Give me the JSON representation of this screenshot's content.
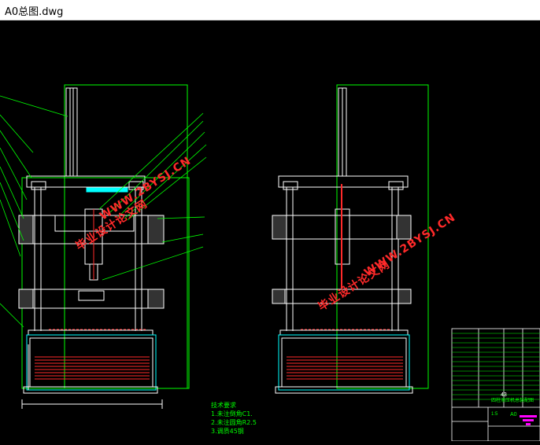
{
  "window": {
    "title": "A0总图.dwg"
  },
  "watermarks": [
    {
      "text": "毕业设计论文网"
    },
    {
      "text": "WWW.2BYSJ.CN"
    },
    {
      "text": "毕业设计论文网"
    },
    {
      "text": "WWW.2BYSJ.CN"
    }
  ],
  "technical_notes": {
    "heading": "技术要求",
    "items": [
      "1.未注倒角C1.",
      "2.未注圆角R2.5",
      "3.调质45钢"
    ]
  },
  "title_block": {
    "drawing_name": "四柱液压机总装配图",
    "sheet_no": "A0",
    "scale": "1:5",
    "page_ref": "43"
  },
  "colors": {
    "background": "#000000",
    "outline": "#ffffff",
    "leader": "#00ff00",
    "section": "#ff2a2a",
    "accent": "#00ffff",
    "hatch": "#ff00ff"
  }
}
